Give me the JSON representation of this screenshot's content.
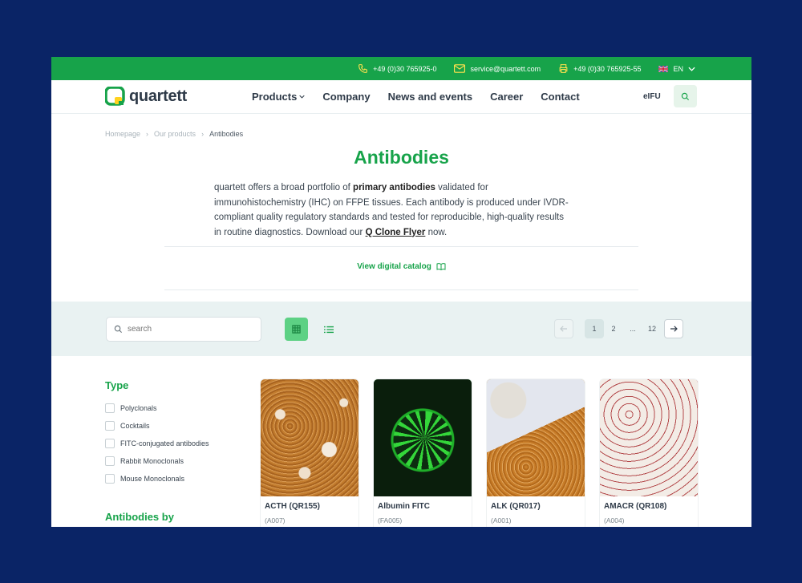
{
  "topbar": {
    "phone": "+49 (0)30 765925-0",
    "email": "service@quartett.com",
    "fax": "+49 (0)30 765925-55",
    "language": "EN"
  },
  "nav": {
    "logo_text": "quartett",
    "items": [
      "Products",
      "Company",
      "News and events",
      "Career",
      "Contact"
    ],
    "eifu": "eIFU"
  },
  "breadcrumb": [
    "Homepage",
    "Our products",
    "Antibodies"
  ],
  "page": {
    "title": "Antibodies",
    "intro_1": "quartett offers a broad portfolio of ",
    "intro_bold": "primary antibodies",
    "intro_2": " validated for immunohistochemistry (IHC) on FFPE tissues. Each antibody is produced under IVDR-compliant quality regulatory standards and tested for reproducible, high-quality results in routine diagnostics. Download our ",
    "intro_link": "Q Clone Flyer",
    "intro_3": " now.",
    "catalog_link": "View digital catalog"
  },
  "toolbar": {
    "search_placeholder": "search",
    "pages": [
      "1",
      "2",
      "...",
      "12"
    ]
  },
  "filters": {
    "type_title": "Type",
    "type_options": [
      "Polyclonals",
      "Cocktails",
      "FITC-conjugated antibodies",
      "Rabbit Monoclonals",
      "Mouse Monoclonals"
    ],
    "next_title": "Antibodies by"
  },
  "products": [
    {
      "name": "ACTH (QR155)",
      "code": "(A007)"
    },
    {
      "name": "Albumin FITC",
      "code": "(FA005)"
    },
    {
      "name": "ALK (QR017)",
      "code": "(A001)"
    },
    {
      "name": "AMACR (QR108)",
      "code": "(A004)"
    }
  ],
  "colors": {
    "brand_green": "#17a34a",
    "background": "#0a2466",
    "toolbar_bg": "#e9f2f2"
  }
}
